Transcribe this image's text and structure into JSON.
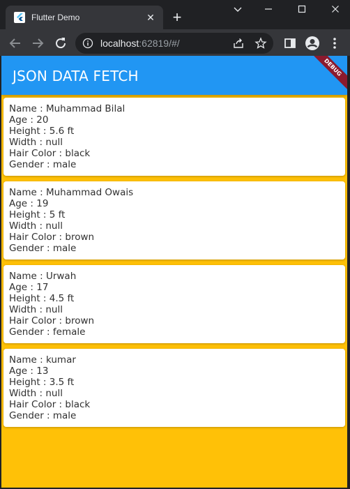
{
  "browser": {
    "tab_title": "Flutter Demo",
    "new_tab_symbol": "+",
    "close_symbol": "✕",
    "url_host": "localhost",
    "url_rest": ":62819/#/"
  },
  "app": {
    "title": "JSON DATA FETCH",
    "debug_banner": "DEBUG",
    "colors": {
      "appbar": "#2196f3",
      "background": "#ffc107",
      "card": "#ffffff"
    }
  },
  "people": [
    {
      "name": "Name : Muhammad Bilal",
      "age": "Age : 20",
      "height": "Height : 5.6 ft",
      "width": "Width : null",
      "hair": "Hair Color : black",
      "gender": "Gender : male"
    },
    {
      "name": "Name : Muhammad Owais",
      "age": "Age : 19",
      "height": "Height : 5 ft",
      "width": "Width : null",
      "hair": "Hair Color : brown",
      "gender": "Gender : male"
    },
    {
      "name": "Name : Urwah",
      "age": "Age : 17",
      "height": "Height : 4.5 ft",
      "width": "Width : null",
      "hair": "Hair Color : brown",
      "gender": "Gender : female"
    },
    {
      "name": "Name : kumar",
      "age": "Age : 13",
      "height": "Height : 3.5 ft",
      "width": "Width : null",
      "hair": "Hair Color : black",
      "gender": "Gender : male"
    }
  ]
}
